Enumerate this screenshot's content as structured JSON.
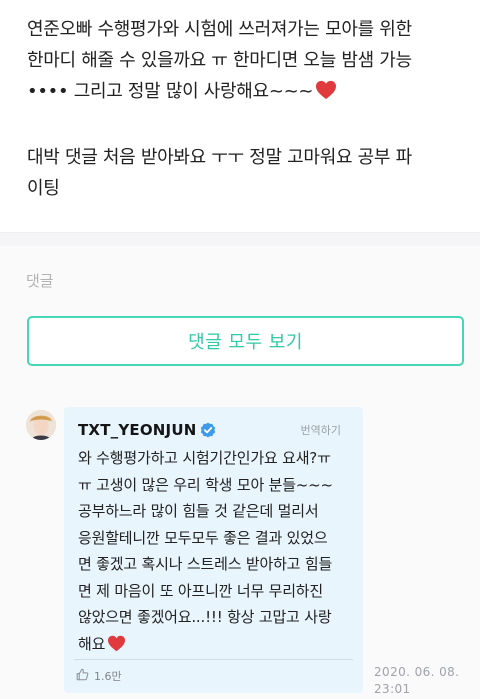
{
  "post": {
    "question_line1": "연준오빠 수행평가와 시험에 쓰러져가는 모아를 위한",
    "question_line2": "한마디 해줄 수 있을까요 ㅠ 한마디면 오늘 밤샘 가능",
    "question_line3": "•••• 그리고 정말 많이 사랑해요~~~",
    "question_heart": "heart-icon",
    "answer_line1": "대박 댓글 처음 받아봐요 ㅜㅜ 정말 고마워요 공부 파",
    "answer_line2": "이팅"
  },
  "comments": {
    "label": "댓글",
    "view_all_label": "댓글 모두 보기"
  },
  "comment": {
    "author": "TXT_YEONJUN",
    "verified_icon": "verified-check-icon",
    "translate_label": "번역하기",
    "body_lines": [
      "와 수행평가하고 시험기간인가요 요새?ㅠ",
      "ㅠ 고생이 많은 우리 학생 모아 분들~~~",
      "공부하느라 많이 힘들 것 같은데 멀리서",
      "응원할테니깐 모두모두 좋은 결과 있었으",
      "면 좋겠고 혹시나 스트레스 받아하고 힘들",
      "면 제 마음이 또 아프니깐 너무 무리하진",
      "않았으면 좋겠어요...!!! 항상 고맙고 사랑",
      "해요"
    ],
    "like_count": "1.6만",
    "date": "2020. 06. 08.",
    "time": "23:01"
  },
  "colors": {
    "accent": "#31c9a6",
    "card_bg": "#e8f5fd",
    "heart": "#e0393e",
    "verified": "#3d9ae8"
  }
}
